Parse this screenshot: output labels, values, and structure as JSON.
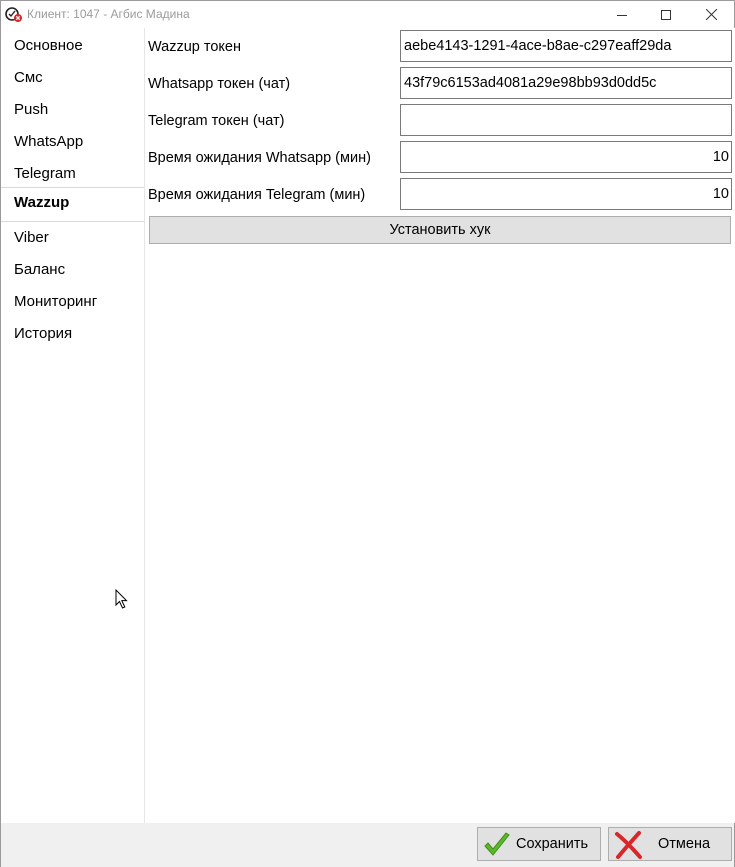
{
  "window": {
    "title": "Клиент: 1047 - Агбис Мадина"
  },
  "sidebar": {
    "items": [
      {
        "label": "Основное",
        "active": false
      },
      {
        "label": "Смс",
        "active": false
      },
      {
        "label": "Push",
        "active": false
      },
      {
        "label": "WhatsApp",
        "active": false
      },
      {
        "label": "Telegram",
        "active": false
      },
      {
        "label": "Wazzup",
        "active": true
      },
      {
        "label": "Viber",
        "active": false
      },
      {
        "label": "Баланс",
        "active": false
      },
      {
        "label": "Мониторинг",
        "active": false
      },
      {
        "label": "История",
        "active": false
      }
    ]
  },
  "form": {
    "fields": [
      {
        "label": "Wazzup токен",
        "value": "aebe4143-1291-4ace-b8ae-c297eaff29da"
      },
      {
        "label": "Whatsapp токен (чат)",
        "value": "43f79c6153ad4081a29e98bb93d0dd5c"
      },
      {
        "label": "Telegram токен (чат)",
        "value": ""
      },
      {
        "label": "Время ожидания Whatsapp (мин)",
        "value": "10"
      },
      {
        "label": "Время ожидания Telegram (мин)",
        "value": "10"
      }
    ],
    "hook_button": "Установить хук"
  },
  "footer": {
    "save_label": "Сохранить",
    "cancel_label": "Отмена"
  },
  "icons": {
    "app": "app-icon",
    "minimize": "minimize-icon",
    "maximize": "maximize-icon",
    "close": "close-icon",
    "save": "checkmark-icon",
    "cancel": "red-x-icon",
    "cursor": "mouse-pointer-icon"
  },
  "colors": {
    "save_check": "#5cb82a",
    "cancel_x": "#d9262a",
    "title_text": "#9b9b9b"
  }
}
